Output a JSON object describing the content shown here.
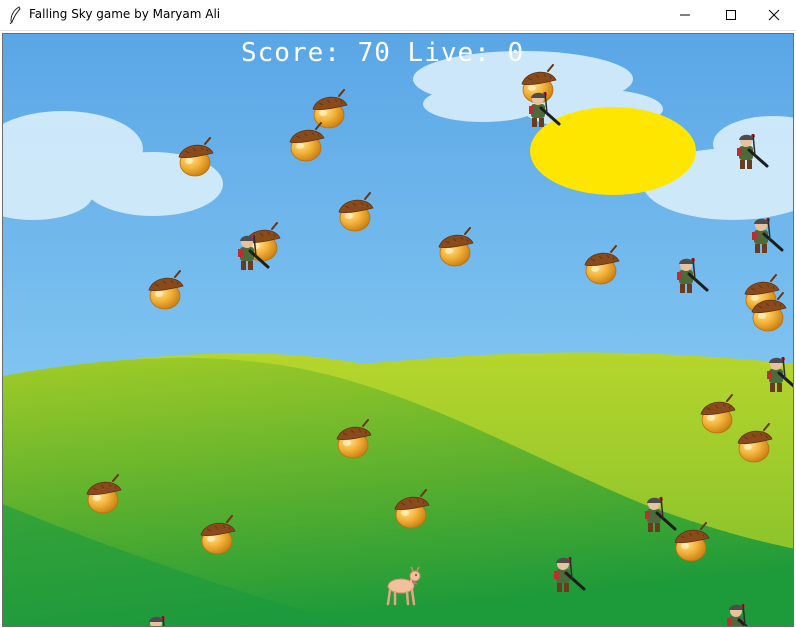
{
  "window": {
    "title": "Falling Sky game by Maryam Ali",
    "app_icon": "feather-icon",
    "controls": [
      "minimize-icon",
      "maximize-icon",
      "close-icon"
    ]
  },
  "hud": {
    "score_label": "Score:",
    "score_value": "70",
    "lives_label": "Live:",
    "lives_value": "0"
  },
  "colors": {
    "sky_top": "#5aa6e6",
    "sky_bottom": "#9fd6f4",
    "sun": "#ffe600",
    "hill_light": "#a2cc27",
    "hill_dark": "#1d9a3a",
    "score_text": "#ffffff"
  },
  "sprites": {
    "player": "deer-icon",
    "falling_good": "acorn-icon",
    "falling_bad": "hunter-icon"
  }
}
